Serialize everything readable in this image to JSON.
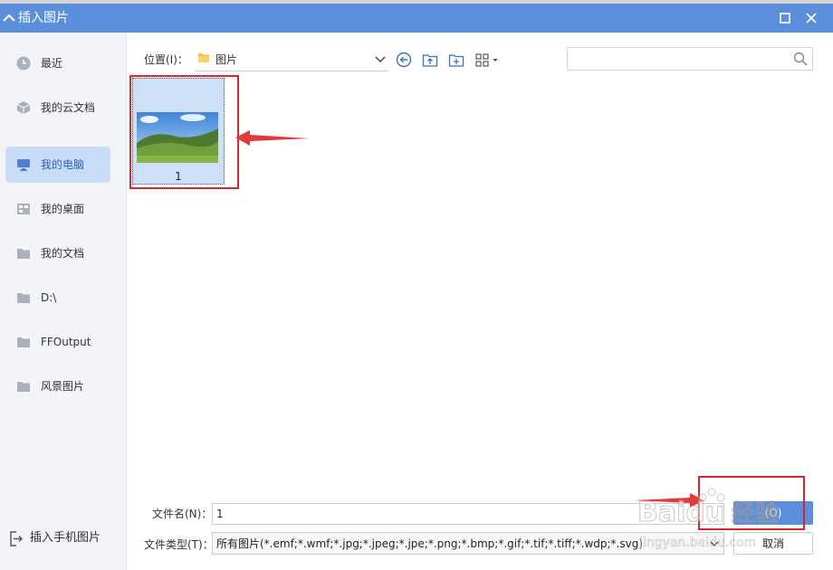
{
  "window": {
    "title": "插入图片",
    "controls": {
      "maximize_icon": "maximize-icon",
      "close_icon": "close-icon"
    }
  },
  "sidebar": {
    "items": [
      {
        "label": "最近",
        "icon": "clock-icon"
      },
      {
        "label": "我的云文档",
        "icon": "cloud-cube-icon"
      },
      {
        "label": "我的电脑",
        "icon": "monitor-icon",
        "selected": true
      },
      {
        "label": "我的桌面",
        "icon": "desktop-icon"
      },
      {
        "label": "我的文档",
        "icon": "folder-icon"
      },
      {
        "label": "D:\\",
        "icon": "folder-icon"
      },
      {
        "label": "FFOutput",
        "icon": "folder-icon"
      },
      {
        "label": "风景图片",
        "icon": "folder-icon"
      }
    ],
    "bottom_link": {
      "label": "插入手机图片",
      "icon": "phone-import-icon"
    }
  },
  "toolbar": {
    "location_label": "位置(I)：",
    "location_value": "图片",
    "buttons": [
      "back-icon",
      "up-folder-icon",
      "new-folder-icon",
      "view-grid-icon"
    ],
    "search": {
      "value": "",
      "placeholder": ""
    }
  },
  "files": [
    {
      "name": "1",
      "selected": true
    }
  ],
  "footer": {
    "filename_label": "文件名(N)：",
    "filename_value": "1",
    "filetype_label": "文件类型(T)：",
    "filetype_value": "所有图片(*.emf;*.wmf;*.jpg;*.jpeg;*.jpe;*.png;*.bmp;*.gif;*.tif;*.tiff;*.wdp;*.svg)",
    "open_label": "(O)",
    "cancel_label": "取消"
  },
  "annotations": {
    "highlight_color": "#d9262b",
    "watermark_brand": "Baidu",
    "watermark_cn": "经验",
    "watermark_url": "jingyan.baidu.com"
  },
  "colors": {
    "accent": "#5b8fdc",
    "selection": "#c9dcf5",
    "sidebar_bg": "#f3f4f8"
  }
}
